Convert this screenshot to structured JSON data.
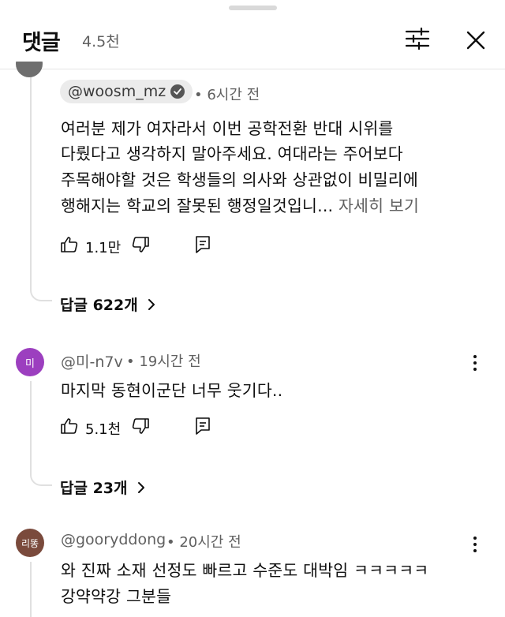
{
  "header": {
    "title": "댓글",
    "count": "4.5천",
    "filter_icon": "sliders-icon",
    "close_icon": "close-icon"
  },
  "comments": [
    {
      "handle": "@woosm_mz",
      "verified": true,
      "time": "• 6시간 전",
      "lines": [
        "여러분 제가 여자라서 이번 공학전환 반대 시위를",
        "다뤘다고 생각하지 말아주세요. 여대라는 주어보다",
        "주목해야할 것은  학생들의 의사와 상관없이 비밀리에",
        "행해지는 학교의 잘못된 행정일것입니... "
      ],
      "more_label": "자세히 보기",
      "likes": "1.1만",
      "replies_label": "답글 622개"
    },
    {
      "avatar_text": "미",
      "avatar_color": "#9c3fbf",
      "handle": "@미-n7v",
      "time": "• 19시간 전",
      "lines": [
        "마지막 동현이군단 너무 웃기다.."
      ],
      "likes": "5.1천",
      "replies_label": "답글 23개"
    },
    {
      "avatar_text": "리똥",
      "avatar_color": "#7a4a3c",
      "handle": "@gooryddong",
      "time": "• 20시간 전",
      "lines": [
        "와 진짜 소재 선정도 빠르고 수준도 대박임 ㅋㅋㅋㅋㅋ",
        "강약약강 그분들"
      ]
    }
  ]
}
